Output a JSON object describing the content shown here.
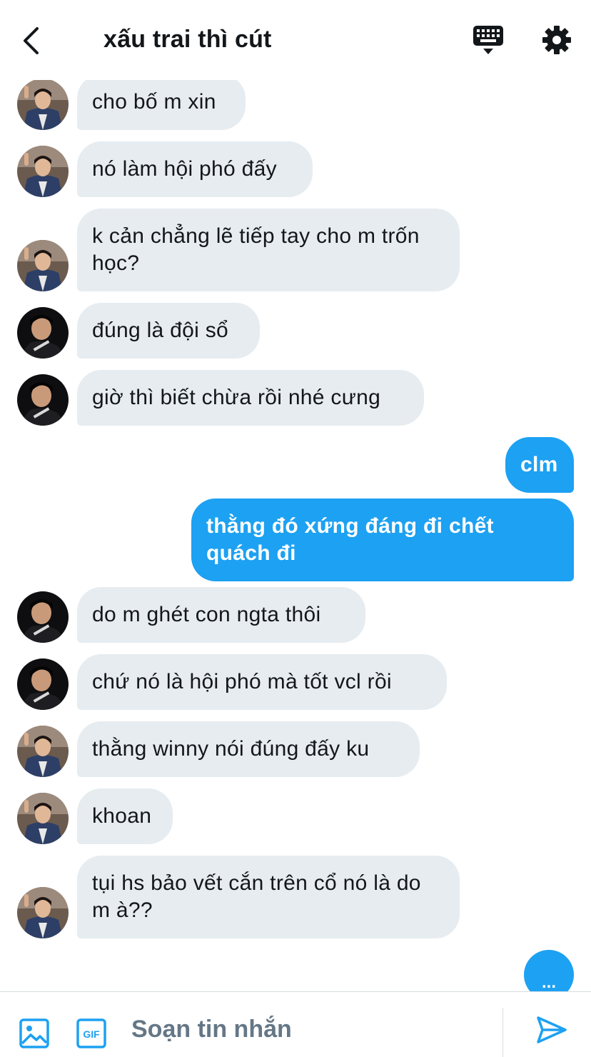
{
  "header": {
    "title": "xấu trai thì cút",
    "back_icon": "chevron-left-icon",
    "keyboard_icon": "keyboard-icon",
    "settings_icon": "gear-icon"
  },
  "colors": {
    "accent": "#1da1f2",
    "incoming_bubble": "#e6ecf0",
    "text": "#14171a",
    "muted": "#657786"
  },
  "messages": [
    {
      "from": "other",
      "text": "cho bố m xin"
    },
    {
      "from": "other",
      "text": "nó làm hội phó đấy"
    },
    {
      "from": "other",
      "text": "k cản chẳng lẽ tiếp tay cho m trốn học?"
    },
    {
      "from": "other",
      "text": "đúng là đội sổ"
    },
    {
      "from": "other",
      "text": "giờ thì biết chừa rồi nhé cưng"
    },
    {
      "from": "me",
      "text": "clm"
    },
    {
      "from": "me",
      "text": "thằng đó xứng đáng đi chết quách đi"
    },
    {
      "from": "other",
      "text": "do m ghét con ngta thôi"
    },
    {
      "from": "other",
      "text": "chứ nó là hội phó mà tốt vcl rồi"
    },
    {
      "from": "other",
      "text": "thằng winny nói đúng đấy ku"
    },
    {
      "from": "other",
      "text": "khoan"
    },
    {
      "from": "other",
      "text": "tụi hs bảo vết cắn trên cổ nó là do m à??"
    }
  ],
  "typing_indicator": "...",
  "composer": {
    "placeholder": "Soạn tin nhắn",
    "image_icon": "image-icon",
    "gif_label": "GIF",
    "send_icon": "send-icon"
  }
}
